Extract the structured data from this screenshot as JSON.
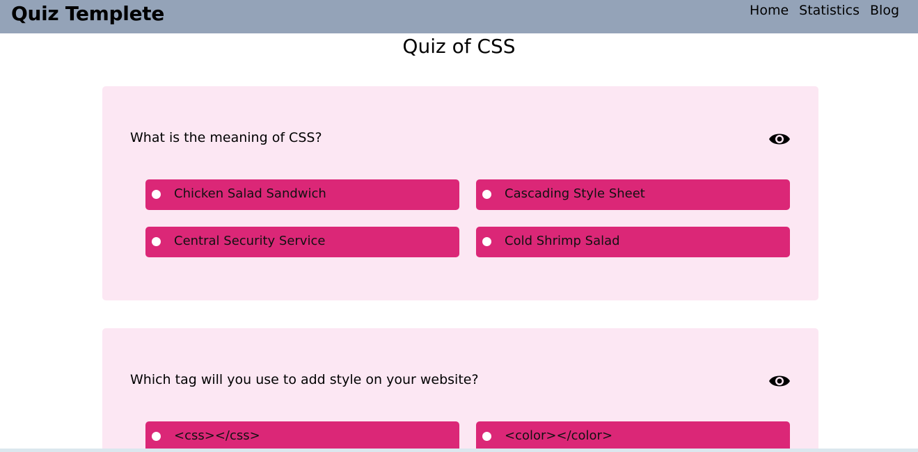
{
  "header": {
    "brand": "Quiz Templete",
    "nav": [
      "Home",
      "Statistics",
      "Blog"
    ]
  },
  "page": {
    "title": "Quiz of CSS"
  },
  "questions": [
    {
      "text": "What is the meaning of CSS?",
      "options": [
        "Chicken Salad Sandwich",
        "Cascading Style Sheet",
        "Central Security Service",
        "Cold Shrimp Salad"
      ]
    },
    {
      "text": "Which tag will you use to add style on your website?",
      "options": [
        "<css></css>",
        "<color></color>"
      ]
    }
  ],
  "colors": {
    "navbar": "#94a3b8",
    "card": "#fce7f3",
    "option": "#db2777"
  },
  "icons": {
    "reveal_answer": "eye-icon"
  }
}
